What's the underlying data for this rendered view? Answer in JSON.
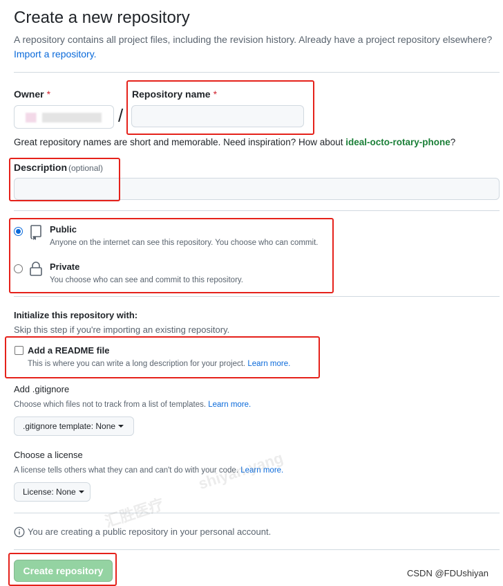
{
  "header": {
    "title": "Create a new repository",
    "subtitle": "A repository contains all project files, including the revision history. Already have a project repository elsewhere?",
    "import_link": "Import a repository."
  },
  "owner": {
    "label": "Owner",
    "required_mark": "*"
  },
  "repo_name": {
    "label": "Repository name",
    "required_mark": "*",
    "value": ""
  },
  "separator": "/",
  "name_hint": {
    "text": "Great repository names are short and memorable. Need inspiration? How about",
    "suggestion": "ideal-octo-rotary-phone",
    "end": "?"
  },
  "description": {
    "label": "Description",
    "optional": "(optional)",
    "value": ""
  },
  "visibility": {
    "public": {
      "label": "Public",
      "desc": "Anyone on the internet can see this repository. You choose who can commit.",
      "checked": true
    },
    "private": {
      "label": "Private",
      "desc": "You choose who can see and commit to this repository.",
      "checked": false
    }
  },
  "init": {
    "heading": "Initialize this repository with:",
    "hint": "Skip this step if you're importing an existing repository."
  },
  "readme": {
    "label": "Add a README file",
    "desc": "This is where you can write a long description for your project.",
    "learn_more": "Learn more."
  },
  "gitignore": {
    "heading": "Add .gitignore",
    "desc": "Choose which files not to track from a list of templates.",
    "learn_more": "Learn more.",
    "button": ".gitignore template: None"
  },
  "license": {
    "heading": "Choose a license",
    "desc": "A license tells others what they can and can't do with your code.",
    "learn_more": "Learn more.",
    "button": "License: None"
  },
  "notice": "You are creating a public repository in your personal account.",
  "create_button": "Create repository",
  "watermark": {
    "csdn": "CSDN @FDUshiyan",
    "overlay_1": "shiyan.yang",
    "overlay_2": "汇胜医疗"
  },
  "colors": {
    "accent": "#0969da",
    "highlight": "#e5211a",
    "create_button_bg": "#94d3a2",
    "suggestion": "#1a7f37"
  }
}
